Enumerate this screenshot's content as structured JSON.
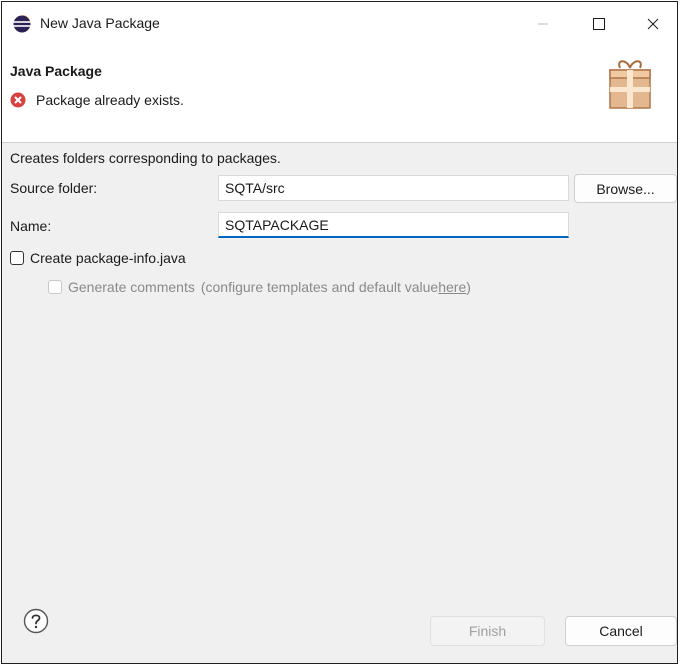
{
  "window": {
    "title": "New Java Package"
  },
  "banner": {
    "heading": "Java Package",
    "message": "Package already exists."
  },
  "form": {
    "description": "Creates folders corresponding to packages.",
    "source_folder_label": "Source folder:",
    "source_folder_value": "SQTA/src",
    "browse_label": "Browse...",
    "name_label": "Name:",
    "name_value": "SQTAPACKAGE",
    "create_package_info_label": "Create package-info.java",
    "generate_comments_label": "Generate comments",
    "generate_comments_hint": "(configure templates and default value ",
    "here_link": "here",
    "hint_close": ")"
  },
  "footer": {
    "finish_label": "Finish",
    "cancel_label": "Cancel"
  },
  "colors": {
    "error_red": "#d9413f",
    "focus_blue": "#0067c0",
    "gift_tan": "#d9a77a"
  },
  "icons": [
    "eclipse-app-icon",
    "minimize-icon",
    "maximize-icon",
    "close-icon",
    "error-icon",
    "package-gift-icon",
    "help-icon"
  ]
}
